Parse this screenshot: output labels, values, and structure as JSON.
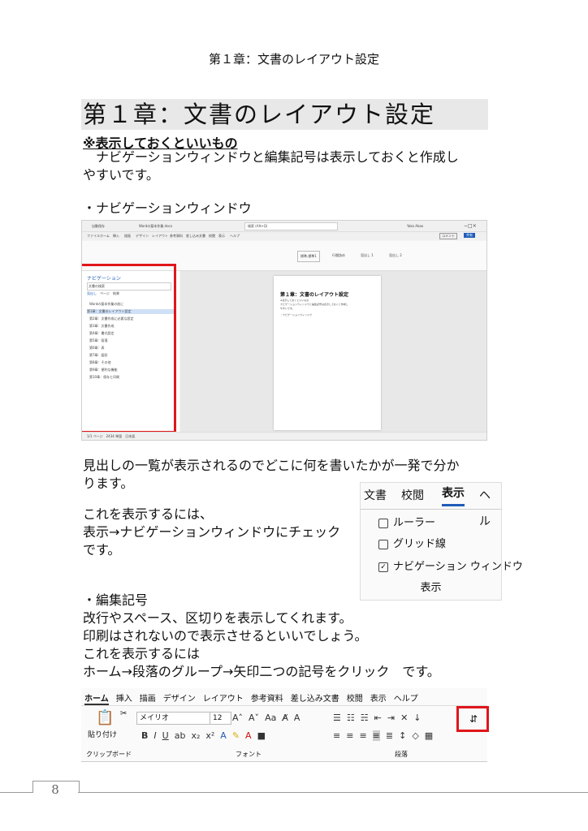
{
  "running_header": "第１章：文書のレイアウト設定",
  "chapter_title": "第１章：文書のレイアウト設定",
  "subheading": "※表示しておくといいもの",
  "intro": [
    "　ナビゲーションウィンドウと編集記号は表示しておくと作成し",
    "やすいです。"
  ],
  "section_nav": "・ナビゲーションウィンドウ",
  "word_window": {
    "qat": "自動保存",
    "file_title": "Wordの基本作業.docx",
    "search": "検索 (Alt+Q)",
    "user": "Yoko Akao",
    "menu": [
      "ファイル",
      "ホーム",
      "挿入",
      "描画",
      "デザイン",
      "レイアウト",
      "参考資料",
      "差し込み文書",
      "校閲",
      "表示",
      "ヘルプ"
    ],
    "comment_btn": "コメント",
    "share_btn": "共有",
    "styles": [
      "標準,標準1",
      "行間詰め",
      "見出し 1",
      "見出し 2"
    ],
    "nav_pane_title": "ナビゲーション",
    "nav_search": "文書の検索",
    "nav_tabs": [
      "見出し",
      "ページ",
      "結果"
    ],
    "nav_headings": [
      "Wordの基本作業の前に",
      "第1章：文書のレイアウト設定",
      "第2章：文書作成に必要な設定",
      "第3章：文書作成",
      "第4章：書式設定",
      "第5章：段落",
      "第6章：表",
      "第7章：図形",
      "第8章：その他",
      "第9章：便利な機能",
      "第10章：保存と印刷"
    ],
    "page_title": "第１章：文書のレイアウト設定",
    "page_lines": [
      "※表示しておくといいもの",
      "ナビゲーションウィンドウと編集記号は表示しておくと作成し",
      "やすいです。",
      "・ナビゲーションウィンドウ"
    ],
    "status": "1/1 ページ　2434 単語　日本語"
  },
  "para_headings": [
    "見出しの一覧が表示されるのでどこに何を書いたかが一発で分か",
    "ります。"
  ],
  "para_howto": [
    "これを表示するには、",
    "表示→ナビゲーションウィンドウにチェック",
    "です。"
  ],
  "view_ribbon": {
    "tabs": [
      "文書",
      "校閲",
      "表示",
      "ヘル"
    ],
    "checkboxes": [
      {
        "label": "ルーラー",
        "checked": false
      },
      {
        "label": "グリッド線",
        "checked": false
      },
      {
        "label": "ナビゲーション ウィンドウ",
        "checked": true
      }
    ],
    "group_label": "表示"
  },
  "section_marks": "・編集記号",
  "marks_lines": [
    "改行やスペース、区切りを表示してくれます。",
    "印刷はされないので表示させるといいでしょう。",
    "これを表示するには",
    "ホーム→段落のグループ→矢印二つの記号をクリック　です。"
  ],
  "home_ribbon": {
    "tabs": [
      "ホーム",
      "挿入",
      "描画",
      "デザイン",
      "レイアウト",
      "参考資料",
      "差し込み文書",
      "校閲",
      "表示",
      "ヘルプ"
    ],
    "paste": "貼り付け",
    "font_name": "メイリオ",
    "font_size": "12",
    "clipboard_label": "クリップボード",
    "font_label": "フォント",
    "paragraph_label": "段落"
  },
  "page_number": "8"
}
